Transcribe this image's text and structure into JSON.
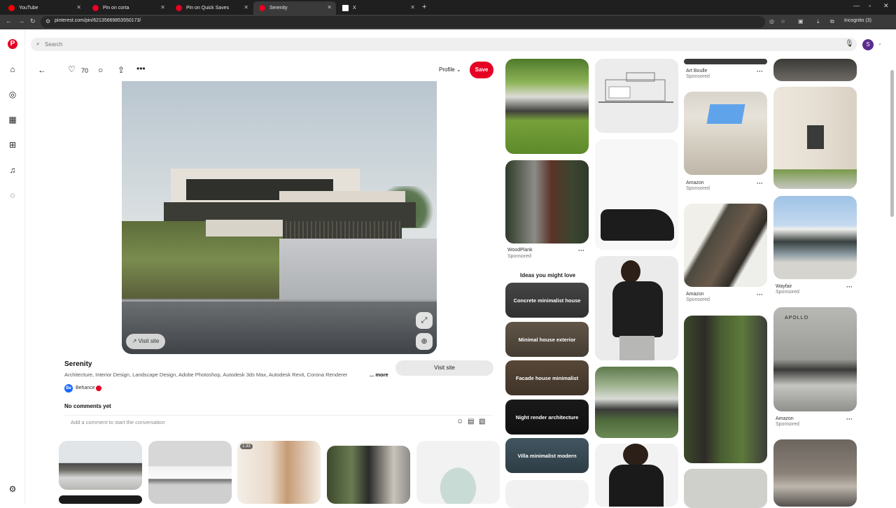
{
  "browser": {
    "tabs": [
      {
        "label": "YouTube",
        "color": "#ff0000"
      },
      {
        "label": "Pin on corta",
        "color": "#e60023"
      },
      {
        "label": "Pin on Quick Saves",
        "color": "#e60023"
      },
      {
        "label": "Serenity",
        "color": "#e60023",
        "active": true
      },
      {
        "label": "X",
        "color": "#ffffff"
      }
    ],
    "url": "pinterest.com/pin/621356698535501​73/",
    "incognito_label": "Incognito (3)"
  },
  "header": {
    "search_placeholder": "Search",
    "avatar_initial": "S"
  },
  "pin": {
    "like_count": "70",
    "profile_label": "Profile",
    "save_label": "Save",
    "visit_chip_label": "↗ Visit site",
    "title": "Serenity",
    "description": "Architecture, Interior Design, Landscape Design, Adobe Photoshop, Autodesk 3ds Max, Autodesk Revit, Corona Renderer",
    "more_label": "... more",
    "visit_site_label": "Visit site",
    "source_name": "Behance",
    "source_logo": "Be",
    "no_comments": "No comments yet",
    "comment_placeholder": "Add a comment to start the conversation"
  },
  "feed": {
    "col1_caption1": "WoodPlank",
    "col1_sponsored1": "Sponsored",
    "ideas_heading": "Ideas you might love",
    "ideas": [
      "Concrete minimalist house",
      "Minimal house exterior",
      "Facade house minimalist",
      "Night render architecture",
      "Villa minimalist modern"
    ],
    "col3_captions": [
      {
        "name": "Art Boulle",
        "sub": "Sponsored"
      },
      {
        "name": "Amazon",
        "sub": "Sponsored"
      },
      {
        "name": "Amazon",
        "sub": "Sponsored"
      }
    ],
    "col4_captions": [
      {
        "name": "Wayfair",
        "sub": "Sponsored"
      },
      {
        "name": "Amazon",
        "sub": "Sponsored"
      }
    ],
    "apollo_text": "APOLLO",
    "video_duration": "1:33"
  }
}
